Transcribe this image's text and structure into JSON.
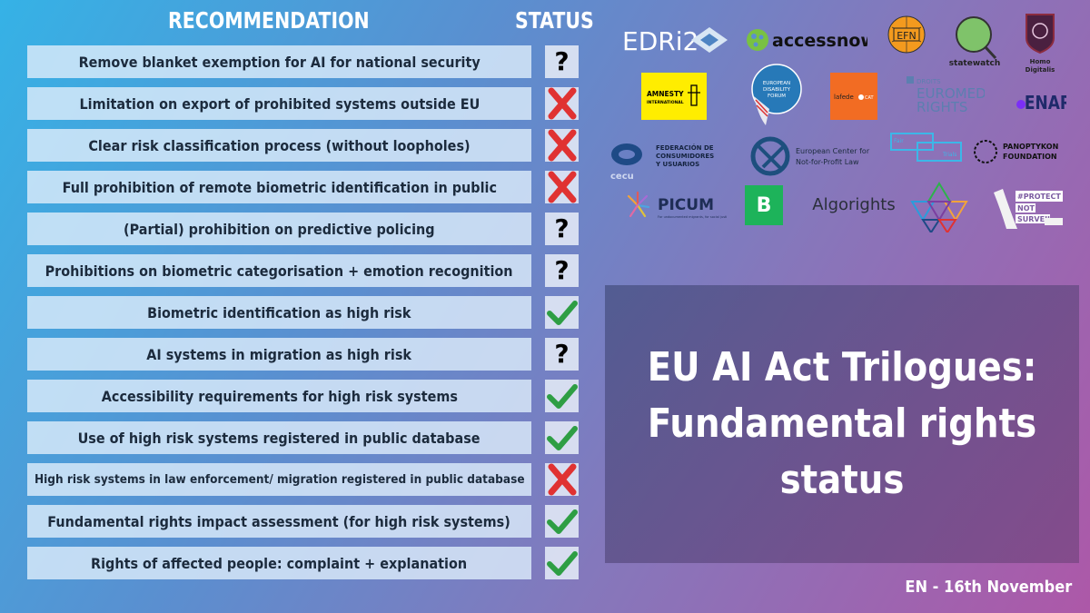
{
  "header": {
    "recommendation_label": "RECOMMENDATION",
    "status_label": "STATUS"
  },
  "status_legend": {
    "yes": {
      "icon": "check-icon",
      "color": "#2e9e44"
    },
    "no": {
      "icon": "cross-icon",
      "color": "#e03232"
    },
    "unknown": {
      "icon": "question-icon",
      "glyph": "?",
      "color": "#000000"
    }
  },
  "rows": [
    {
      "recommendation": "Remove blanket exemption for AI for national security",
      "status": "unknown"
    },
    {
      "recommendation": "Limitation on export of prohibited systems outside EU",
      "status": "no"
    },
    {
      "recommendation": "Clear risk classification process (without loopholes)",
      "status": "no"
    },
    {
      "recommendation": "Full prohibition of remote biometric identification in public",
      "status": "no"
    },
    {
      "recommendation": "(Partial) prohibition on predictive policing",
      "status": "unknown"
    },
    {
      "recommendation": "Prohibitions on biometric categorisation + emotion recognition",
      "status": "unknown"
    },
    {
      "recommendation": "Biometric identification as high risk",
      "status": "yes"
    },
    {
      "recommendation": "AI systems in migration as high risk",
      "status": "unknown"
    },
    {
      "recommendation": "Accessibility requirements for high risk systems",
      "status": "yes"
    },
    {
      "recommendation": "Use of high risk systems registered in public database",
      "status": "yes"
    },
    {
      "recommendation": "High risk systems in law enforcement/ migration registered in public database",
      "status": "no",
      "small": true
    },
    {
      "recommendation": "Fundamental rights impact assessment (for high risk systems)",
      "status": "yes"
    },
    {
      "recommendation": "Rights of affected people: complaint + explanation",
      "status": "yes"
    }
  ],
  "logos": [
    {
      "name": "EDRi 20",
      "text": "EDRi2",
      "icon": "edri-logo-icon"
    },
    {
      "name": "accessnow",
      "text": "accessnow",
      "icon": "accessnow-logo-icon"
    },
    {
      "name": "EFN",
      "text": "EFN",
      "icon": "efn-logo-icon"
    },
    {
      "name": "statewatch",
      "text": "statewatch",
      "icon": "statewatch-logo-icon"
    },
    {
      "name": "Homo Digitalis",
      "text": "Homo Digitalis",
      "icon": "homo-digitalis-logo-icon"
    },
    {
      "name": "Amnesty International",
      "text": "AMNESTY INTERNATIONAL",
      "icon": "amnesty-logo-icon"
    },
    {
      "name": "European Disability Forum",
      "text": "EUROPEAN DISABILITY FORUM",
      "icon": "edf-logo-icon"
    },
    {
      "name": "lafede.cat",
      "text": "lafede CAT",
      "icon": "lafede-logo-icon"
    },
    {
      "name": "EuroMed Rights",
      "text": "DROITS EUROMED RIGHTS",
      "icon": "euromed-logo-icon"
    },
    {
      "name": "ENAR",
      "text": "ENAR",
      "icon": "enar-logo-icon"
    },
    {
      "name": "CECU",
      "text": "FEDERACIÓN DE CONSUMIDORES Y USUARIOS",
      "sub": "cecu",
      "icon": "cecu-logo-icon"
    },
    {
      "name": "European Center for Not-for-Profit Law",
      "text": "European Center for Not-for-Profit Law",
      "icon": "ecnl-logo-icon"
    },
    {
      "name": "Fair Trials",
      "text": "Fair Trials",
      "icon": "fair-trials-logo-icon"
    },
    {
      "name": "Panoptykon Foundation",
      "text": "PANOPTYKON FOUNDATION",
      "icon": "panoptykon-logo-icon"
    },
    {
      "name": "PICUM",
      "text": "PICUM",
      "sub": "For undocumented migrants, for social justice.",
      "icon": "picum-logo-icon"
    },
    {
      "name": "Bits of Freedom",
      "text": "B",
      "icon": "bits-of-freedom-logo-icon"
    },
    {
      "name": "Algorights",
      "text": "Algorights",
      "icon": "algorights-logo-icon"
    },
    {
      "name": "Triangles logo",
      "text": "",
      "icon": "triangles-logo-icon"
    },
    {
      "name": "Protect Not Surveil",
      "text": "#PROTECT NOT SURVEIL",
      "icon": "protect-not-surveil-logo-icon"
    }
  ],
  "title": "EU AI Act Trilogues: Fundamental rights status",
  "footer": "EN - 16th November"
}
